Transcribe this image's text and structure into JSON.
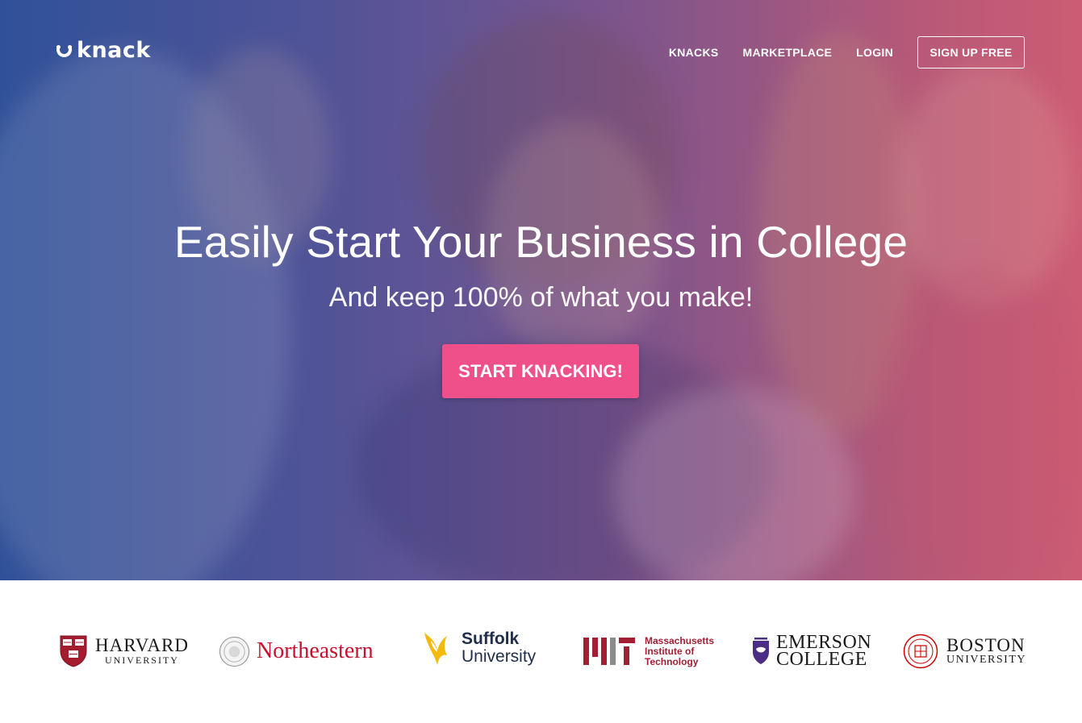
{
  "brand": {
    "logo_text": "knack",
    "logo_icon": "smile-u-icon"
  },
  "nav": {
    "links": [
      "KNACKS",
      "MARKETPLACE",
      "LOGIN"
    ],
    "signup_label": "SIGN UP FREE"
  },
  "hero": {
    "headline": "Easily Start Your Business in College",
    "subheadline": "And keep 100% of what you make!",
    "cta_label": "START KNACKING!",
    "cta_color": "#f0508a"
  },
  "universities": {
    "harvard": {
      "line1": "HARVARD",
      "line2": "UNIVERSITY"
    },
    "northeastern": {
      "name": "Northeastern"
    },
    "suffolk": {
      "line1": "Suffolk",
      "line2": "University"
    },
    "mit": {
      "line1": "Massachusetts",
      "line2": "Institute of",
      "line3": "Technology"
    },
    "emerson": {
      "line1": "EMERSON",
      "line2": "COLLEGE"
    },
    "boston": {
      "line1": "BOSTON",
      "line2": "UNIVERSITY"
    }
  }
}
